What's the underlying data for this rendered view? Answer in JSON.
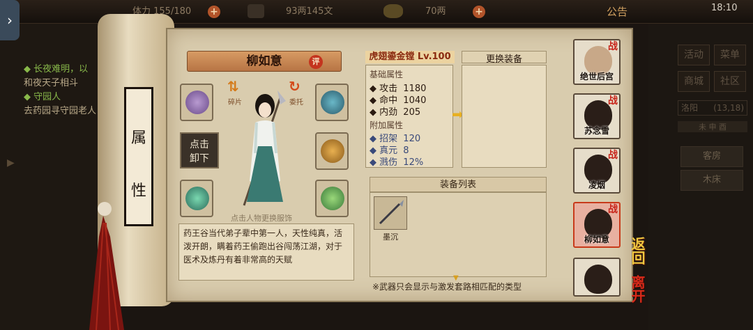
{
  "topbar": {
    "stamina": "体力 155/180",
    "money": "93两145文",
    "gold": "70两",
    "notice": "公告",
    "clock": "18:10"
  },
  "quests": [
    {
      "title": "长夜难明，以",
      "sub": "和夜天子相斗"
    },
    {
      "title": "守园人",
      "sub": "去药园寻守园老人"
    }
  ],
  "right_menu": {
    "buttons": [
      "活动",
      "菜单",
      "商城",
      "社区"
    ],
    "location": "洛阳",
    "coords": "(13,18)",
    "time": "未 申 酉",
    "rooms": [
      "客房",
      "木床"
    ]
  },
  "scroll": {
    "chars": [
      "属",
      "性"
    ]
  },
  "character": {
    "name": "柳如意",
    "rate_label": "评",
    "fragment_label": "碎片",
    "delegate_label": "委托",
    "unequip_label": [
      "点击",
      "卸下"
    ],
    "hint": "点击人物更换服饰",
    "description": "药王谷当代弟子辈中第一人，天性纯真，活泼开朗，瞒着药王偷跑出谷闯荡江湖，对于医术及炼丹有着非常高的天赋"
  },
  "equipment": {
    "name": "虎翅鎏金镗 Lv.100",
    "base_title": "基础属性",
    "base_stats": [
      {
        "label": "攻击",
        "value": "1180"
      },
      {
        "label": "命中",
        "value": "1040"
      },
      {
        "label": "内劲",
        "value": "205"
      }
    ],
    "extra_title": "附加属性",
    "extra_stats": [
      {
        "label": "招架",
        "value": "120"
      },
      {
        "label": "真元",
        "value": "8"
      },
      {
        "label": "溅伤",
        "value": "12%"
      }
    ],
    "change_label": "更换装备",
    "list_label": "装备列表",
    "list_items": [
      "墨沉"
    ],
    "note": "※武器只会显示与激发套路相匹配的类型"
  },
  "party": [
    {
      "name": "绝世后宫",
      "battle": "战"
    },
    {
      "name": "苏念雪",
      "battle": "战"
    },
    {
      "name": "凌烟",
      "battle": "战"
    },
    {
      "name": "柳如意",
      "battle": "战"
    },
    {
      "name": "",
      "battle": ""
    }
  ],
  "actions": {
    "back": "返回",
    "leave": "离开"
  },
  "colors": {
    "accent": "#c8241a",
    "parchment": "#d9ccae",
    "gold": "#e8b020"
  }
}
